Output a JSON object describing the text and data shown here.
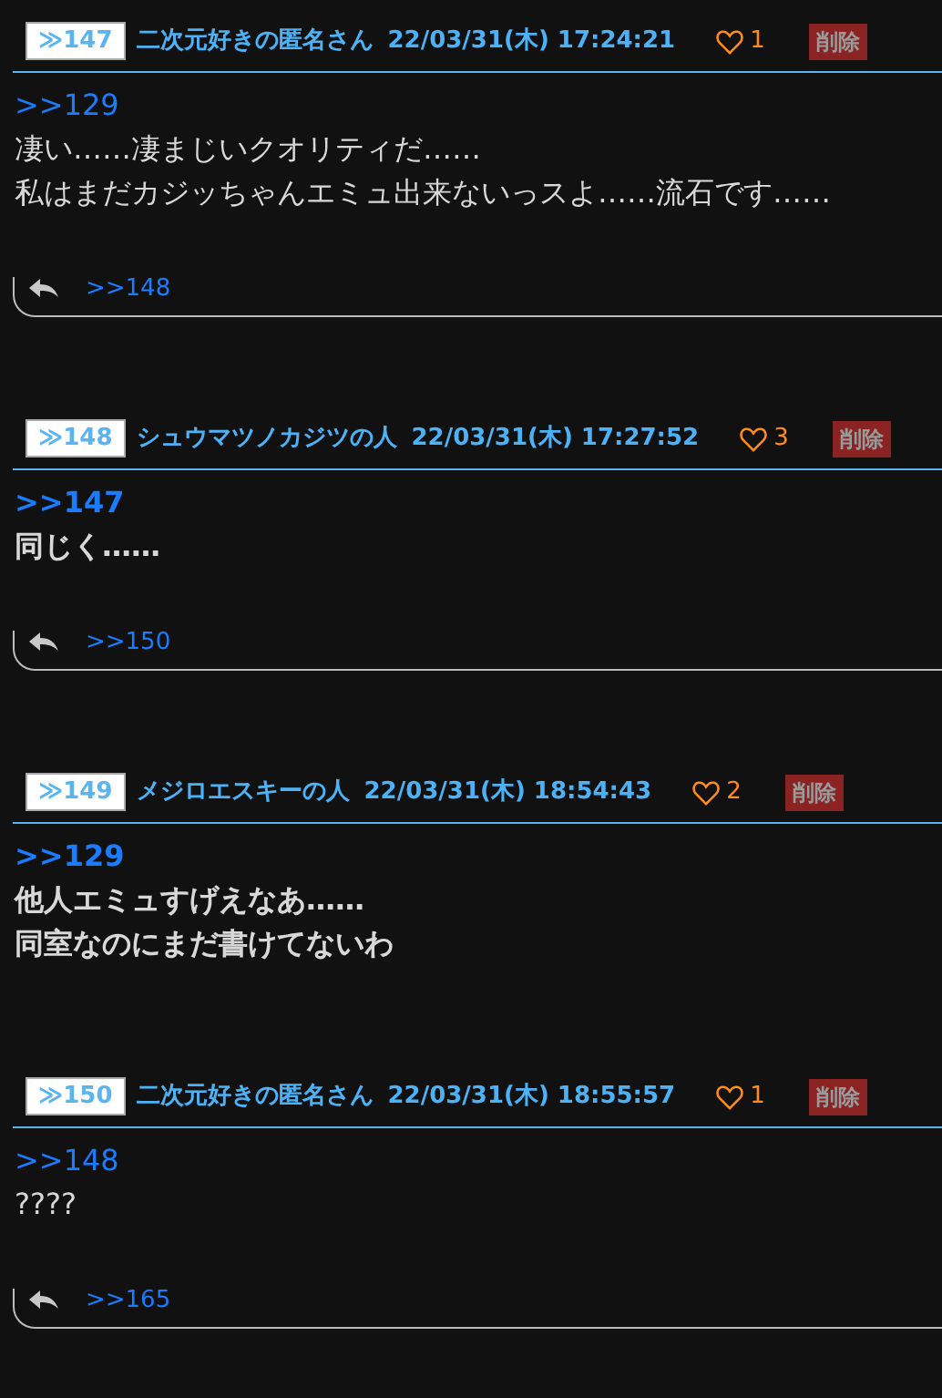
{
  "posts": [
    {
      "number": "≫147",
      "name": "二次元好きの匿名さん",
      "date": "22/03/31(木) 17:24:21",
      "likes": "1",
      "delete_label": "削除",
      "anchor": ">>129",
      "bold": false,
      "lines": [
        "凄い……凄まじいクオリティだ……",
        "私はまだカジッちゃんエミュ出来ないっスよ……流石です……"
      ],
      "replies": [
        ">>148"
      ]
    },
    {
      "number": "≫148",
      "name": "シュウマツノカジツの人",
      "date": "22/03/31(木) 17:27:52",
      "likes": "3",
      "delete_label": "削除",
      "anchor": ">>147",
      "bold": true,
      "lines": [
        "同じく……"
      ],
      "replies": [
        ">>150"
      ]
    },
    {
      "number": "≫149",
      "name": "メジロエスキーの人",
      "date": "22/03/31(木) 18:54:43",
      "likes": "2",
      "delete_label": "削除",
      "anchor": ">>129",
      "bold": true,
      "lines": [
        "他人エミュすげえなあ……",
        "同室なのにまだ書けてないわ"
      ]
    },
    {
      "number": "≫150",
      "name": "二次元好きの匿名さん",
      "date": "22/03/31(木) 18:55:57",
      "likes": "1",
      "delete_label": "削除",
      "anchor": ">>148",
      "bold": false,
      "lines": [
        "????"
      ],
      "replies": [
        ">>165"
      ]
    }
  ]
}
